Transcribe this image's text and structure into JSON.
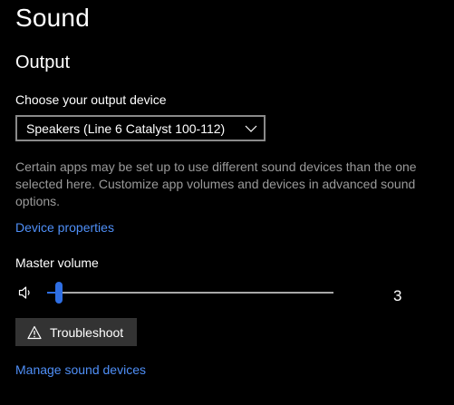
{
  "page": {
    "title": "Sound"
  },
  "output": {
    "section_title": "Output",
    "device_label": "Choose your output device",
    "selected_device": "Speakers (Line 6 Catalyst 100-112)",
    "description": "Certain apps may be set up to use different sound devices than the one selected here. Customize app volumes and devices in advanced sound options.",
    "device_properties_link": "Device properties",
    "master_volume_label": "Master volume",
    "volume_value": "3",
    "volume_level_percent": 3,
    "troubleshoot_label": "Troubleshoot",
    "manage_devices_link": "Manage sound devices"
  },
  "icons": {
    "speaker": "speaker-icon",
    "warning": "warning-icon",
    "chevron": "chevron-down-icon"
  },
  "colors": {
    "background": "#000000",
    "text": "#ffffff",
    "secondary_text": "#9a9a9a",
    "accent": "#2f6fe4",
    "link": "#4f8ff7",
    "button_bg": "#333333"
  }
}
